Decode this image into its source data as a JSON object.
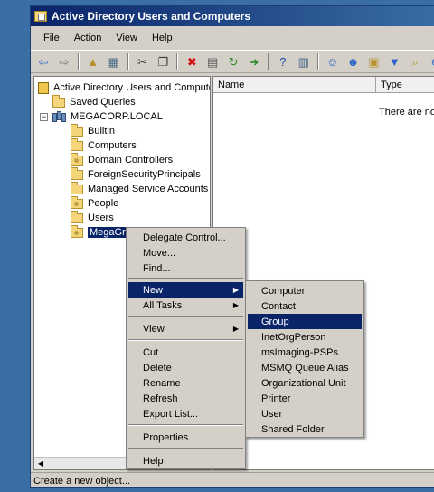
{
  "window": {
    "title": "Active Directory Users and Computers"
  },
  "menubar": [
    "File",
    "Action",
    "View",
    "Help"
  ],
  "toolbar": [
    {
      "icon": "back-arrow-icon",
      "glyph": "⇦",
      "color": "#2a62c9"
    },
    {
      "icon": "forward-arrow-icon",
      "glyph": "⇨",
      "color": "#6a6a6a"
    },
    {
      "sep": true
    },
    {
      "icon": "up-folder-icon",
      "glyph": "▲",
      "color": "#b8922c"
    },
    {
      "icon": "console-tree-icon",
      "glyph": "▦",
      "color": "#4a6a8a"
    },
    {
      "sep": true
    },
    {
      "icon": "cut-icon",
      "glyph": "✂",
      "color": "#3a3a3a"
    },
    {
      "icon": "copy-icon",
      "glyph": "❐",
      "color": "#3a3a3a"
    },
    {
      "sep": true
    },
    {
      "icon": "delete-icon",
      "glyph": "✖",
      "color": "#d01010"
    },
    {
      "icon": "properties-sheet-icon",
      "glyph": "▤",
      "color": "#5a5a5a"
    },
    {
      "icon": "refresh-icon",
      "glyph": "↻",
      "color": "#2a8a2a"
    },
    {
      "icon": "export-icon",
      "glyph": "➜",
      "color": "#2a8a2a"
    },
    {
      "sep": true
    },
    {
      "icon": "help-icon",
      "glyph": "?",
      "color": "#1a4aa0"
    },
    {
      "icon": "show-pane-icon",
      "glyph": "▥",
      "color": "#4a6a8a"
    },
    {
      "sep": true
    },
    {
      "icon": "new-user-icon",
      "glyph": "☺",
      "color": "#2a62c9"
    },
    {
      "icon": "new-group-icon",
      "glyph": "☻",
      "color": "#2a62c9"
    },
    {
      "icon": "new-ou-icon",
      "glyph": "▣",
      "color": "#b8922c"
    },
    {
      "icon": "filter-icon",
      "glyph": "▼",
      "color": "#2a62c9"
    },
    {
      "icon": "find-icon",
      "glyph": "⌕",
      "color": "#b8922c"
    },
    {
      "icon": "add-to-group-icon",
      "glyph": "⊕",
      "color": "#2a62c9"
    }
  ],
  "tree": {
    "root": "Active Directory Users and Computers",
    "items": [
      {
        "label": "Saved Queries",
        "type": "folder"
      },
      {
        "label": "MEGACORP.LOCAL",
        "type": "domain",
        "expander": "−"
      },
      {
        "label": "Builtin",
        "type": "folder"
      },
      {
        "label": "Computers",
        "type": "folder"
      },
      {
        "label": "Domain Controllers",
        "type": "ou"
      },
      {
        "label": "ForeignSecurityPrincipals",
        "type": "folder"
      },
      {
        "label": "Managed Service Accounts",
        "type": "folder"
      },
      {
        "label": "People",
        "type": "ou"
      },
      {
        "label": "Users",
        "type": "folder"
      },
      {
        "label": "MegaGroups",
        "type": "ou",
        "selected": true
      }
    ]
  },
  "list": {
    "columns": [
      "Name",
      "Type"
    ],
    "empty_message": "There are no"
  },
  "context_menu": {
    "items": [
      "Delegate Control...",
      "Move...",
      "Find...",
      "New",
      "All Tasks",
      "View",
      "Cut",
      "Delete",
      "Rename",
      "Refresh",
      "Export List...",
      "Properties",
      "Help"
    ]
  },
  "submenu": {
    "items": [
      "Computer",
      "Contact",
      "Group",
      "InetOrgPerson",
      "msImaging-PSPs",
      "MSMQ Queue Alias",
      "Organizational Unit",
      "Printer",
      "User",
      "Shared Folder"
    ]
  },
  "status": {
    "text": "Create a new object..."
  },
  "colors": {
    "highlight": "#0a246a",
    "desktop": "#3a6ea5",
    "chrome": "#d4d0c8"
  }
}
